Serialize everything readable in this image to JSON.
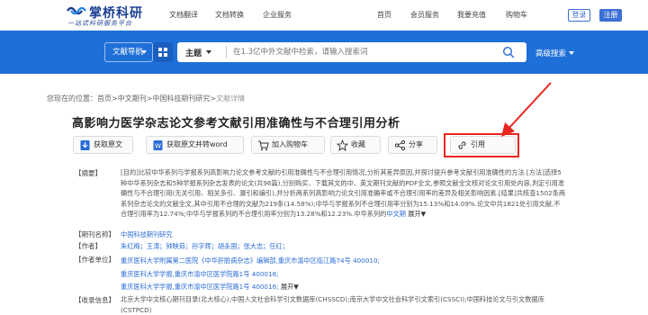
{
  "brand": {
    "name": "掌桥科研",
    "slogan": "一站式科研服务平台"
  },
  "topnav": {
    "items": [
      "文档翻译",
      "文档转换",
      "企业服务"
    ],
    "right_items": [
      "首页",
      "会员服务",
      "我要充值",
      "购物车"
    ],
    "login": "登录",
    "register": "注册"
  },
  "search": {
    "nav_label": "文献导航",
    "topic": "主题",
    "placeholder": "在1.3亿中外文献中检索，请输入搜索词",
    "advanced": "高级搜索"
  },
  "breadcrumb": {
    "prefix": "您现在的位置：",
    "items": [
      "首页",
      "中文期刊",
      "中国科技期刊研究",
      "文献详情"
    ]
  },
  "article": {
    "title": "高影响力医学杂志论文参考文献引用准确性与不合理引用分析",
    "actions": [
      "获取原文",
      "获取原文并转word",
      "加入购物车",
      "收藏",
      "分享",
      "引用"
    ],
    "fields": {
      "abstract_label": "【摘要】",
      "abstract": "[目的]比较中华系列与学报系列高影响力论文参考文献的引用准确性与不合理引用情况,分析其差异原因,并探讨提升参考文献引用准确性的方法.[方法]选择5种中华系列杂志和5种学报系列杂志发表的论文(共96篇),分别购买、下载其文的中、英文期刊文献的PDF全文,参照文献全文核对论文引用处内容,判定引用准确性与不合理引用(无关引用、相关多引、漏引和编引),并分析两系列高影响力论文引用准确率或不合理引用率的差异及相关影响因素.[结果]共核查1502条两系列杂志论文的文献全文,其中引用不合理的文献为219条(14.58%);中华与学报系列不合理引用率分别为15.13%和14.09%.论文中共1821处引用文献,不合理引用率为12.74%;中华与学报系列的不合理引用率分别为13.28%和12.23%.中华系列的",
      "abstract_more_a": "中文期",
      "abstract_more_b": "展开▼",
      "journal_label": "【期刊名称】",
      "journal": "中国科技期刊研究",
      "authors_label": "【作者】",
      "authors": "朱红梅；王涛；钟映茹；孙字辉；胡永国；张大志；任红；",
      "units_label": "【作者单位】",
      "units": [
        "重庆医科大学附属第二医院《中华肝脏病杂志》编辑部,重庆市渝中区临江路74号 400010;",
        "重庆医科大学学报,重庆市渝中区医学院路1号 400016;",
        "重庆医科大学学报,重庆市渝中区医学院路1号 400016;"
      ],
      "units_more": "展开▼",
      "index_label": "【收录信息】",
      "index": "北京大学中文核心期刊目录(北大核心);中国人文社会科学引文数据库(CHSSCD);南京大学中文社会科学引文索引(CSSCI);中国科技论文与引文数据库(CSTPCD)"
    }
  },
  "colors": {
    "brand_blue": "#1c3f94",
    "band_blue": "#1f6fd8",
    "link_blue": "#2b6cd6",
    "highlight_red": "#e8261f"
  }
}
